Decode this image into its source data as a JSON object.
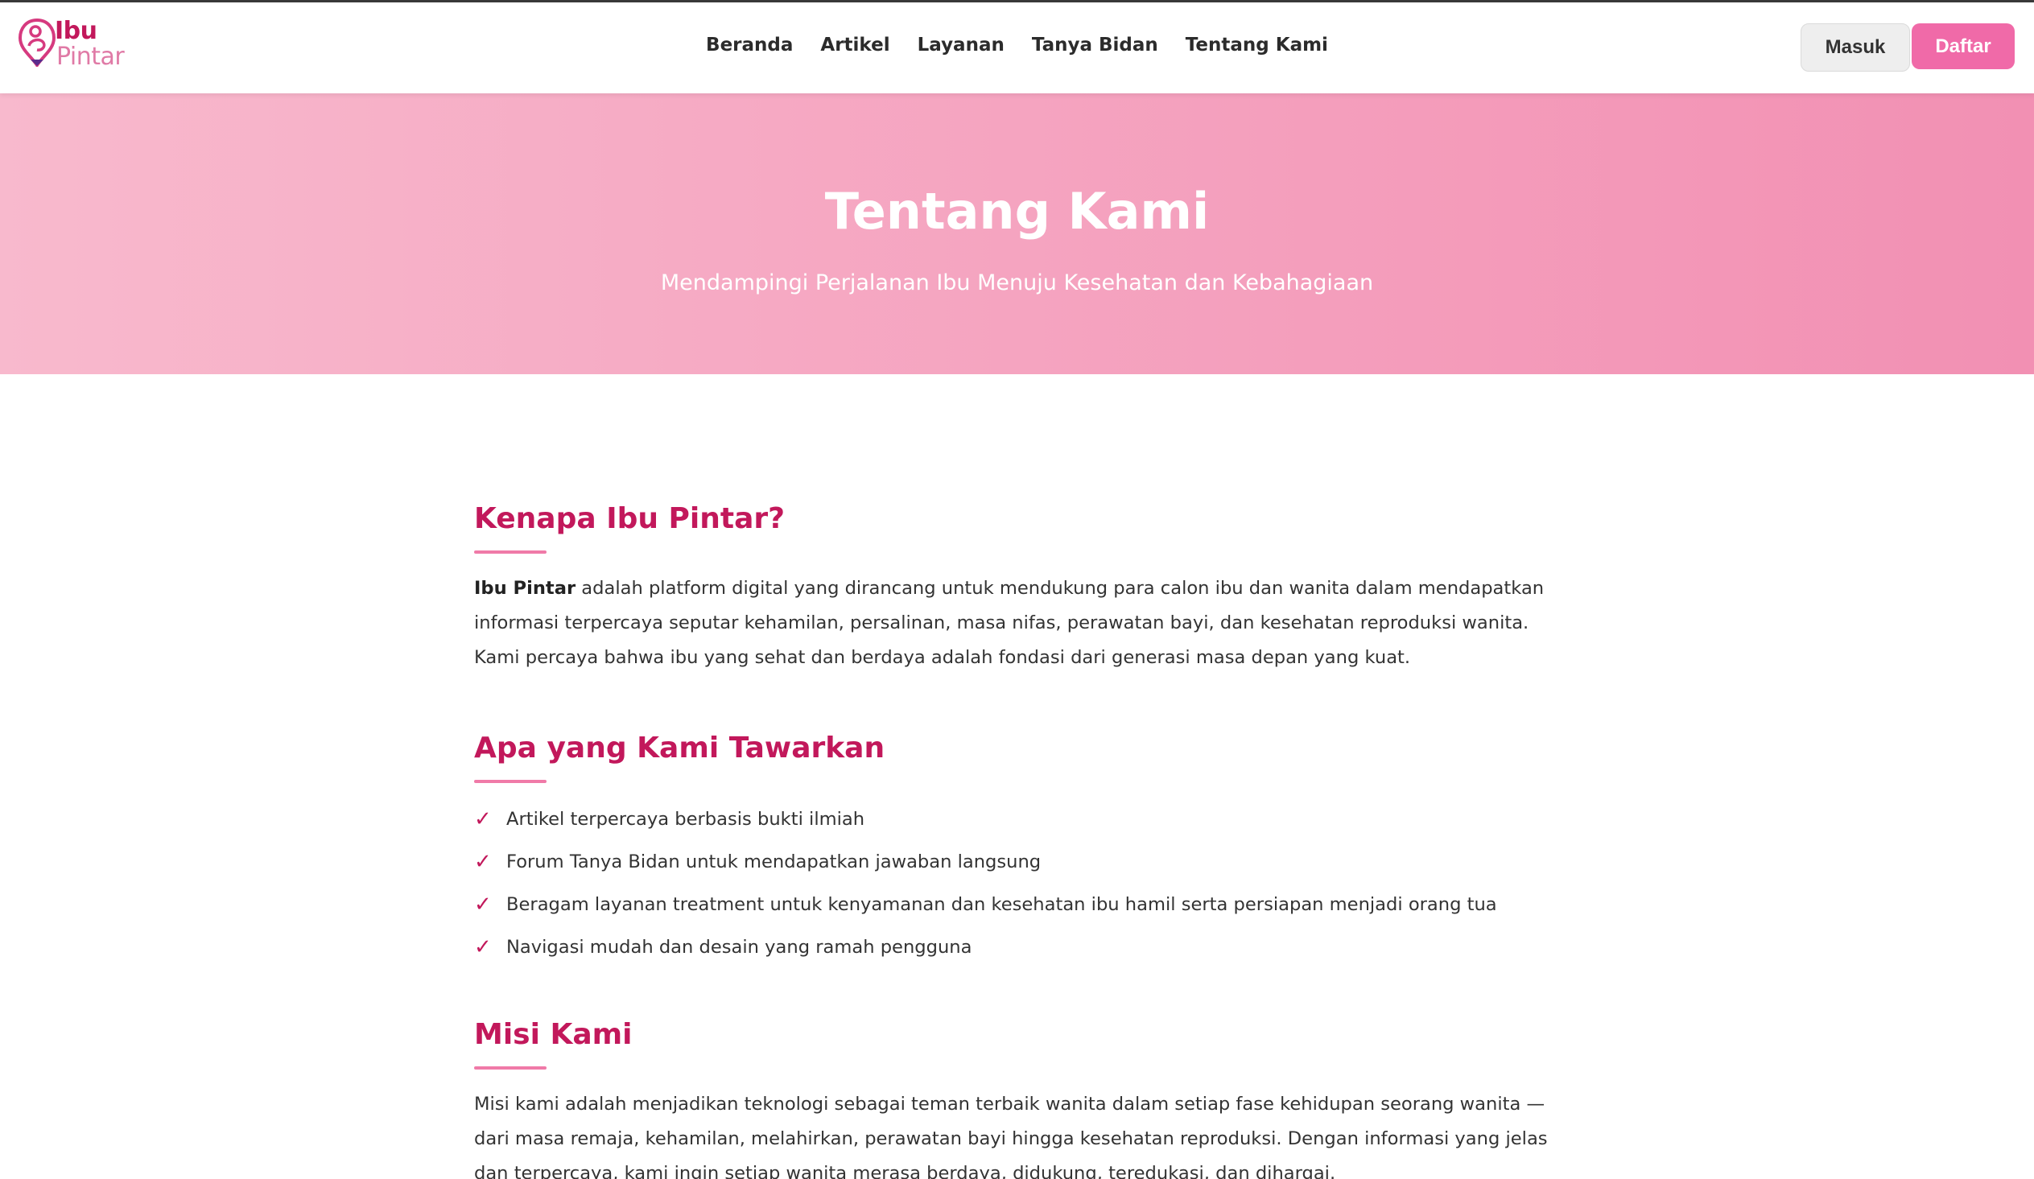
{
  "brand": {
    "line1": "Ibu",
    "line2": "Pintar",
    "primary": "#c2185b",
    "accent": "#f06aa8"
  },
  "nav": {
    "items": [
      "Beranda",
      "Artikel",
      "Layanan",
      "Tanya Bidan",
      "Tentang Kami"
    ],
    "login_label": "Masuk",
    "register_label": "Daftar"
  },
  "hero": {
    "title": "Tentang Kami",
    "subtitle": "Mendampingi Perjalanan Ibu Menuju Kesehatan dan Kebahagiaan"
  },
  "sections": {
    "why": {
      "title": "Kenapa Ibu Pintar?",
      "brand_bold": "Ibu Pintar",
      "text": " adalah platform digital yang dirancang untuk mendukung para calon ibu dan wanita dalam mendapatkan informasi terpercaya seputar kehamilan, persalinan, masa nifas, perawatan bayi, dan kesehatan reproduksi wanita. Kami percaya bahwa ibu yang sehat dan berdaya adalah fondasi dari generasi masa depan yang kuat."
    },
    "offer": {
      "title": "Apa yang Kami Tawarkan",
      "items": [
        "Artikel terpercaya berbasis bukti ilmiah",
        "Forum Tanya Bidan untuk mendapatkan jawaban langsung",
        "Beragam layanan treatment untuk kenyamanan dan kesehatan ibu hamil serta persiapan menjadi orang tua",
        "Navigasi mudah dan desain yang ramah pengguna"
      ],
      "check_icon": "check-icon"
    },
    "mission": {
      "title": "Misi Kami",
      "text": "Misi kami adalah menjadikan teknologi sebagai teman terbaik wanita dalam setiap fase kehidupan seorang wanita — dari masa remaja, kehamilan, melahirkan, perawatan bayi hingga kesehatan reproduksi. Dengan informasi yang jelas dan terpercaya, kami ingin setiap wanita merasa berdaya, didukung, teredukasi, dan dihargai."
    }
  }
}
